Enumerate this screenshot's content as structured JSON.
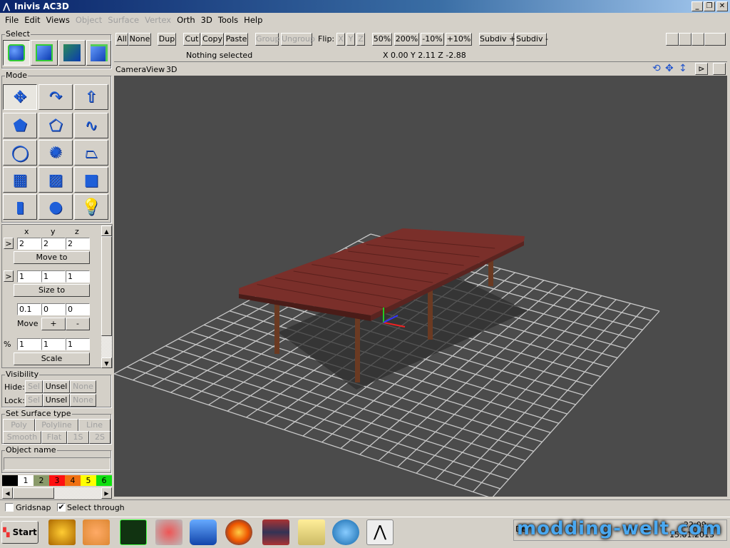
{
  "window": {
    "title": "Inivis AC3D",
    "min": "_",
    "restore": "❐",
    "close": "✕"
  },
  "menu": [
    {
      "label": "File",
      "enabled": true
    },
    {
      "label": "Edit",
      "enabled": true
    },
    {
      "label": "Views",
      "enabled": true
    },
    {
      "label": "Object",
      "enabled": false
    },
    {
      "label": "Surface",
      "enabled": false
    },
    {
      "label": "Vertex",
      "enabled": false
    },
    {
      "label": "Orth",
      "enabled": true
    },
    {
      "label": "3D",
      "enabled": true
    },
    {
      "label": "Tools",
      "enabled": true
    },
    {
      "label": "Help",
      "enabled": true
    }
  ],
  "toolbar": {
    "all": "All",
    "none": "None",
    "dup": "Dup",
    "cut": "Cut",
    "copy": "Copy",
    "paste": "Paste",
    "group": "Group",
    "ungroup": "Ungroup",
    "flip": "Flip:",
    "x": "X",
    "y": "Y",
    "z": "Z",
    "z50": "50%",
    "z200": "200%",
    "m10": "-10%",
    "p10": "+10%",
    "subdiv_plus": "Subdiv +",
    "subdiv_minus": "Subdiv -"
  },
  "status": {
    "selection": "Nothing selected",
    "coords": "X 0.00 Y 2.11 Z -2.88"
  },
  "viewport_menu": [
    "Camera",
    "View",
    "3D"
  ],
  "left": {
    "select_label": "Select",
    "mode_label": "Mode",
    "axes": [
      "x",
      "y",
      "z"
    ],
    "expand": ">",
    "position": [
      "2",
      "2",
      "2"
    ],
    "move_to": "Move to",
    "size": [
      "1",
      "1",
      "1"
    ],
    "size_to": "Size to",
    "step": [
      "0.1",
      "0",
      "0"
    ],
    "move": "Move",
    "plus": "+",
    "minus": "-",
    "pct": "%",
    "scale_vals": [
      "1",
      "1",
      "1"
    ],
    "scale": "Scale",
    "visibility": "Visibility",
    "hide": "Hide:",
    "lock": "Lock:",
    "sel": "Sel",
    "unsel": "Unsel",
    "none": "None",
    "surface_type": "Set Surface type",
    "poly": "Poly",
    "polyline": "Polyline",
    "line": "Line",
    "smooth": "Smooth",
    "flat": "Flat",
    "s1": "1S",
    "s2": "2S",
    "object_name": "Object name",
    "object_name_value": ""
  },
  "palette": [
    {
      "label": "",
      "color": "#000000"
    },
    {
      "label": "1",
      "color": "#ffffff"
    },
    {
      "label": "2",
      "color": "#8a9a6a"
    },
    {
      "label": "3",
      "color": "#ff1010"
    },
    {
      "label": "4",
      "color": "#f07010"
    },
    {
      "label": "5",
      "color": "#ffff00"
    },
    {
      "label": "6",
      "color": "#10e010"
    }
  ],
  "bottom": {
    "gridsnap": "Gridsnap",
    "gridsnap_checked": false,
    "select_through": "Select through",
    "select_through_checked": true
  },
  "taskbar": {
    "start": "Start",
    "watermark": "modding-welt.com",
    "lang": "DE",
    "time": "22:09",
    "date": "15.01.2013"
  }
}
